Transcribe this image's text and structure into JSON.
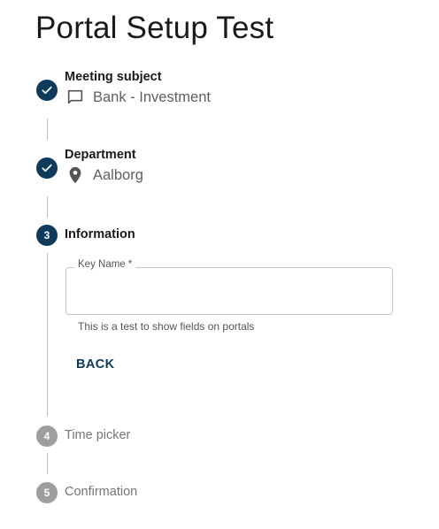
{
  "page": {
    "title": "Portal Setup Test"
  },
  "steps": [
    {
      "status": "completed",
      "label": "Meeting subject",
      "value": "Bank - Investment",
      "value_icon": "chat-bubble-icon"
    },
    {
      "status": "completed",
      "label": "Department",
      "value": "Aalborg",
      "value_icon": "location-pin-icon"
    },
    {
      "status": "active",
      "number": "3",
      "label": "Information",
      "field": {
        "label": "Key Name *",
        "value": "",
        "helper_text": "This is a test to show fields on portals"
      },
      "back_label": "BACK"
    },
    {
      "status": "pending",
      "number": "4",
      "label": "Time picker"
    },
    {
      "status": "pending",
      "number": "5",
      "label": "Confirmation"
    }
  ],
  "colors": {
    "active": "#0e3a5c",
    "pending": "#9e9e9e",
    "connector": "#bdbdbd"
  }
}
